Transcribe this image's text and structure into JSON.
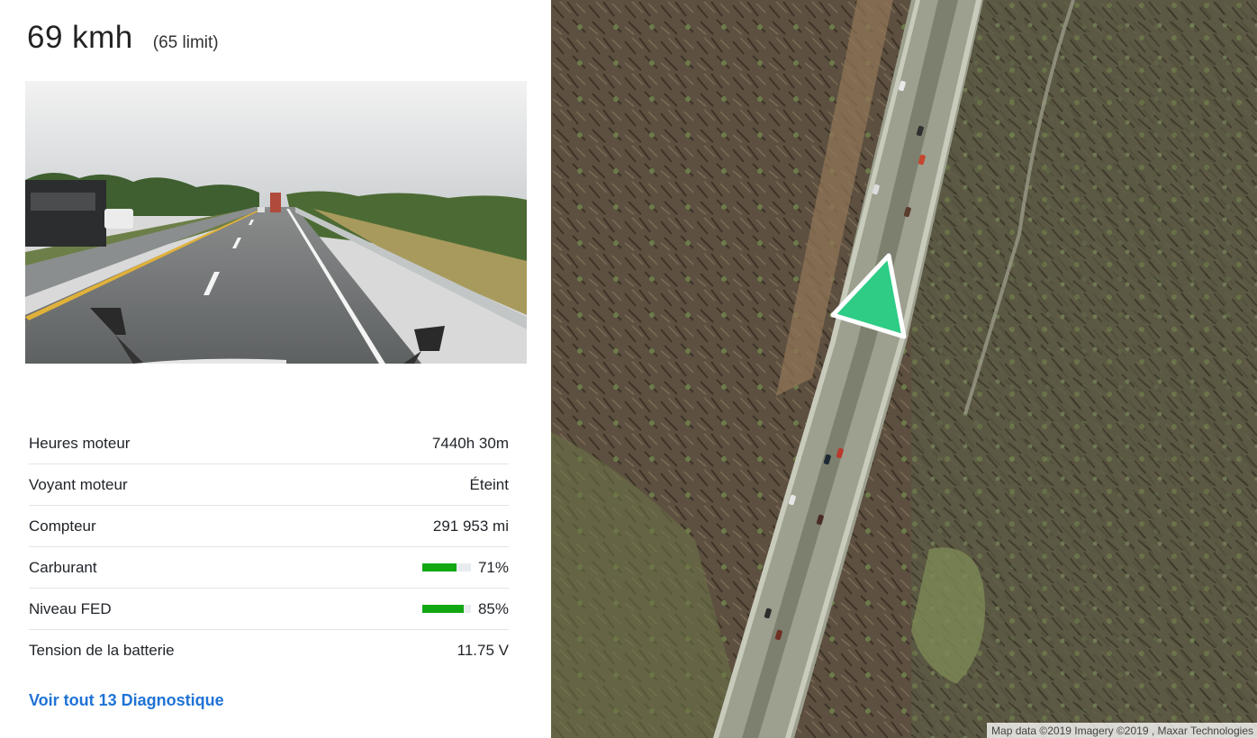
{
  "speed": {
    "value": "69 kmh",
    "limit": "(65 limit)"
  },
  "dashcam": {
    "alt": "Dashcam view"
  },
  "diagnostics": [
    {
      "label": "Heures moteur",
      "value": "7440h 30m"
    },
    {
      "label": "Voyant moteur",
      "value": "Éteint"
    },
    {
      "label": "Compteur",
      "value": "291 953 mi"
    },
    {
      "label": "Carburant",
      "value": "71%",
      "level": 0.71
    },
    {
      "label": "Niveau FED",
      "value": "85%",
      "level": 0.85
    },
    {
      "label": "Tension de la batterie",
      "value": "11.75 V"
    }
  ],
  "view_all_link": "Voir tout 13 Diagnostique",
  "map": {
    "attribution": "Map data ©2019 Imagery ©2019 , Maxar Technologies",
    "marker_color": "#2ecc85",
    "marker_icon": "navigation-arrow-icon"
  },
  "colors": {
    "link": "#1f73d6",
    "gauge_fill": "#12a812"
  }
}
